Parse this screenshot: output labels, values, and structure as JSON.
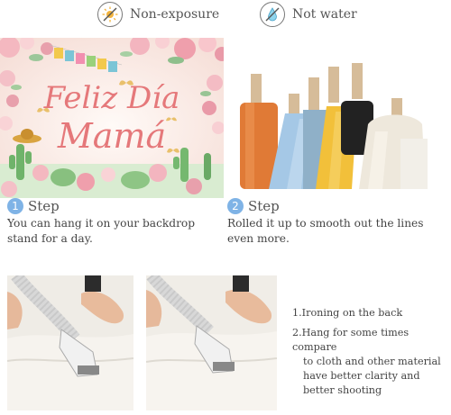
{
  "features": [
    {
      "label": "Non-exposure",
      "icon": "no-sun-icon"
    },
    {
      "label": "Not water",
      "icon": "no-water-drop-icon"
    }
  ],
  "banner": {
    "line1": "Feliz Día",
    "line2": "Mamá"
  },
  "steps": [
    {
      "number": "1",
      "title": "Step",
      "description_line1": "You can hang it on your backdrop",
      "description_line2": "stand for a day."
    },
    {
      "number": "2",
      "title": "Step",
      "description_line1": "Rolled it up to smooth out the lines",
      "description_line2": "even more."
    }
  ],
  "notes": {
    "item1": "1.Ironing on the back",
    "item2_line1": "2.Hang for some times compare",
    "item2_line2": "to cloth and other material",
    "item2_line3": "have better clarity and",
    "item2_line4": "better shooting"
  },
  "colors": {
    "accent_blue": "#7fb3e6",
    "banner_pink": "#e07b7b",
    "banner_bg": "#fdf1ee"
  }
}
